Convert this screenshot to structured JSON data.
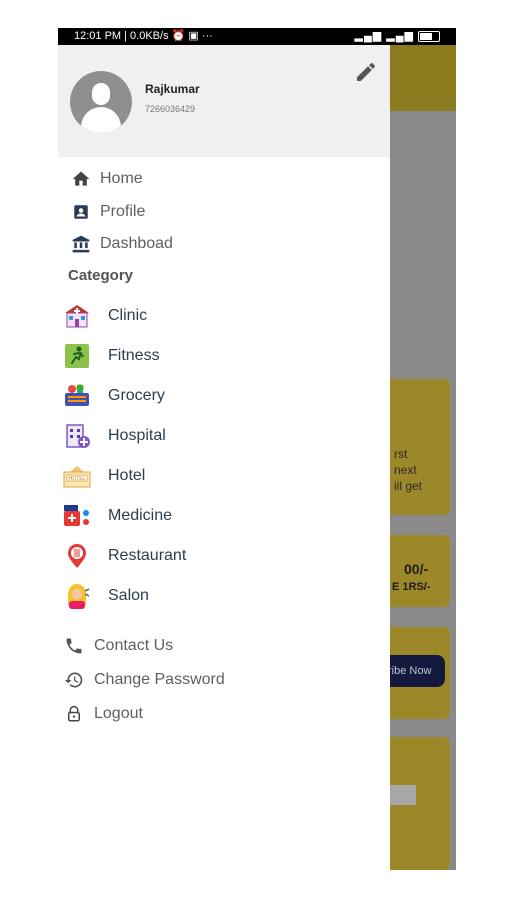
{
  "status_bar": {
    "left": "12:01 PM | 0.0KB/s ⏰ ▣ ···",
    "right": "▂▄▆ ▂▄▆"
  },
  "drawer": {
    "user": {
      "name": "Rajkumar",
      "phone": "7266036429"
    },
    "nav": [
      {
        "label": "Home",
        "icon": "home-icon"
      },
      {
        "label": "Profile",
        "icon": "profile-card-icon"
      },
      {
        "label": "Dashboad",
        "icon": "bank-icon"
      }
    ],
    "category_title": "Category",
    "categories": [
      {
        "label": "Clinic",
        "icon": "clinic-icon"
      },
      {
        "label": "Fitness",
        "icon": "fitness-icon"
      },
      {
        "label": "Grocery",
        "icon": "grocery-icon"
      },
      {
        "label": "Hospital",
        "icon": "hospital-icon"
      },
      {
        "label": "Hotel",
        "icon": "hotel-icon"
      },
      {
        "label": "Medicine",
        "icon": "medicine-icon"
      },
      {
        "label": "Restaurant",
        "icon": "restaurant-icon"
      },
      {
        "label": "Salon",
        "icon": "salon-icon"
      }
    ],
    "bottom": [
      {
        "label": "Contact Us",
        "icon": "phone-icon"
      },
      {
        "label": "Change Password",
        "icon": "history-icon"
      },
      {
        "label": "Logout",
        "icon": "lock-icon"
      }
    ]
  },
  "background_app": {
    "card1_lines": [
      "rst",
      "next",
      "ill get"
    ],
    "price": "00/-",
    "price_note": "E 1RS/-",
    "subscribe_label": "ribe Now"
  },
  "colors": {
    "drawer_bg": "#ffffff",
    "profile_bg": "#f0f0f0",
    "scrim_yellow": "#9c8729",
    "button_navy": "#141a3d"
  }
}
